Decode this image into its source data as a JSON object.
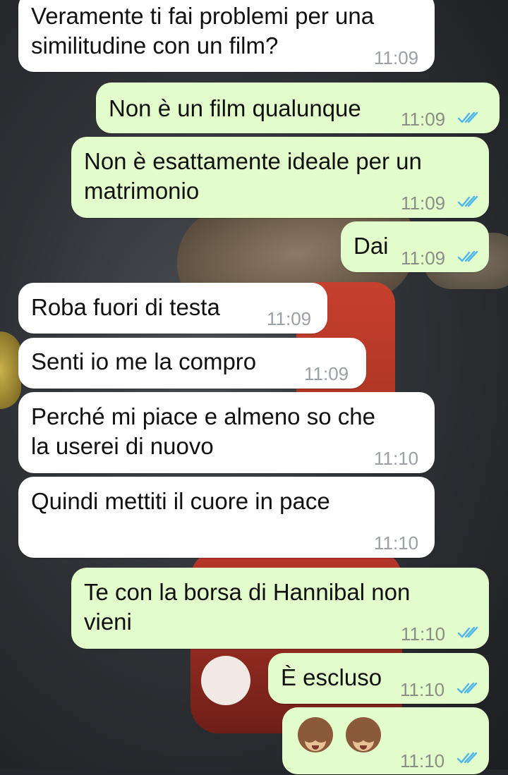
{
  "messages": [
    {
      "id": "m1",
      "dir": "in",
      "lines": [
        "Veramente ti fai problemi per una",
        "similitudine con un film?"
      ],
      "time": "11:09"
    },
    {
      "id": "m2",
      "dir": "out",
      "lines": [
        "Non è un film qualunque"
      ],
      "time": "11:09",
      "status": "read"
    },
    {
      "id": "m3",
      "dir": "out",
      "lines": [
        "Non è esattamente ideale per un",
        "matrimonio"
      ],
      "time": "11:09",
      "status": "read"
    },
    {
      "id": "m4",
      "dir": "out",
      "lines": [
        "Dai"
      ],
      "time": "11:09",
      "status": "read"
    },
    {
      "id": "m5",
      "dir": "in",
      "lines": [
        "Roba fuori di testa"
      ],
      "time": "11:09"
    },
    {
      "id": "m6",
      "dir": "in",
      "lines": [
        "Senti io me la compro"
      ],
      "time": "11:09"
    },
    {
      "id": "m7",
      "dir": "in",
      "lines": [
        "Perché mi piace e almeno so che",
        "la userei di nuovo"
      ],
      "time": "11:10"
    },
    {
      "id": "m8",
      "dir": "in",
      "lines": [
        "Quindi mettiti il cuore in pace"
      ],
      "time": "11:10"
    },
    {
      "id": "m9",
      "dir": "out",
      "lines": [
        "Te con la borsa di Hannibal non",
        "vieni"
      ],
      "time": "11:10",
      "status": "read"
    },
    {
      "id": "m10",
      "dir": "out",
      "lines": [
        "È escluso"
      ],
      "time": "11:10",
      "status": "read"
    },
    {
      "id": "m11",
      "dir": "out",
      "emoji": [
        "see-no-evil-monkey",
        "see-no-evil-monkey"
      ],
      "time": "11:10",
      "status": "read"
    }
  ],
  "colors": {
    "incoming": "#ffffff",
    "outgoing": "#e2fdcb",
    "read_ticks": "#4fb6ec"
  }
}
